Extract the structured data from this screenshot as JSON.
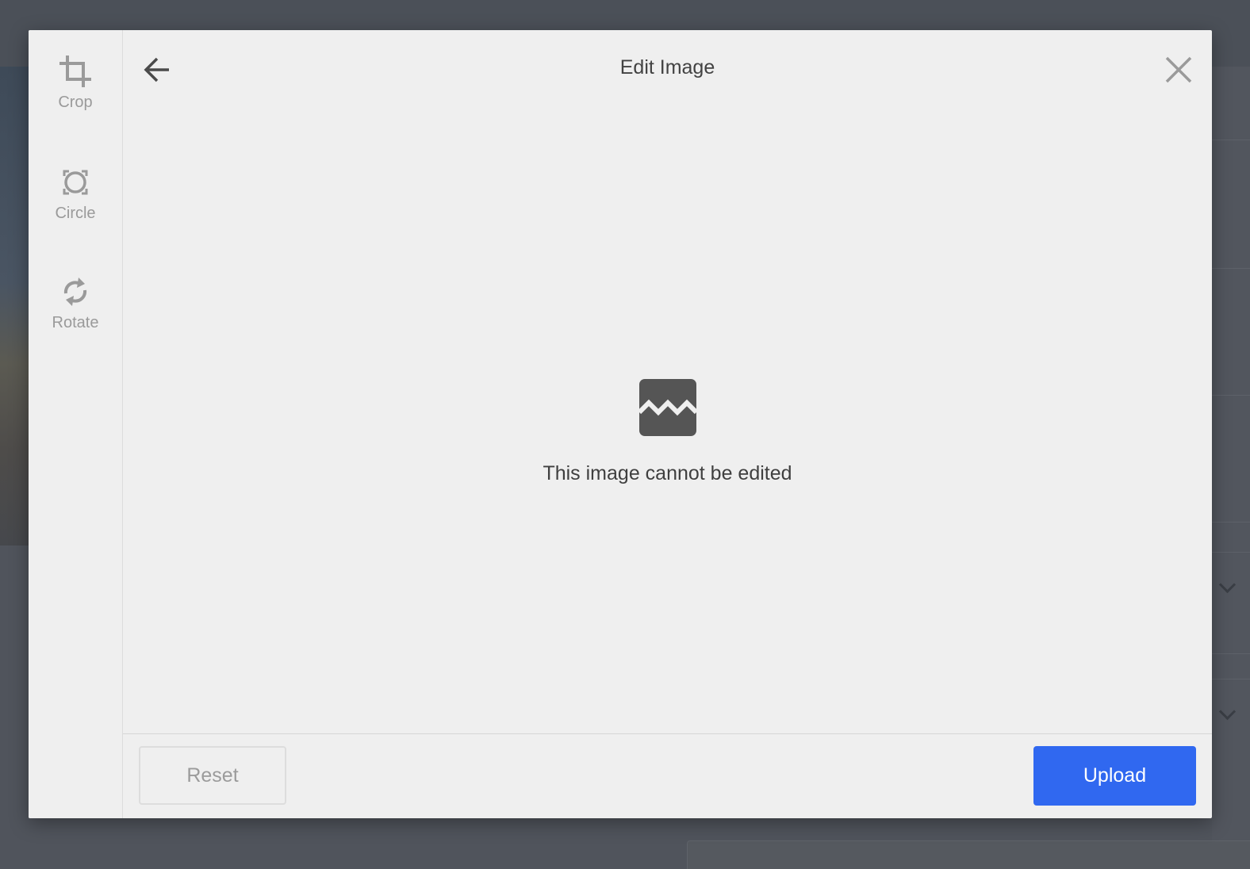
{
  "modal": {
    "title": "Edit Image",
    "message": "This image cannot be edited"
  },
  "tools": [
    {
      "label": "Crop",
      "icon": "crop-icon"
    },
    {
      "label": "Circle",
      "icon": "circle-crop-icon"
    },
    {
      "label": "Rotate",
      "icon": "rotate-icon"
    }
  ],
  "footer": {
    "reset_label": "Reset",
    "upload_label": "Upload"
  },
  "colors": {
    "accent": "#3068f0",
    "modal_bg": "#efefef",
    "overlay": "#4f535b"
  },
  "icons": {
    "back": "arrow-left-icon",
    "close": "close-icon",
    "error": "broken-image-icon"
  }
}
